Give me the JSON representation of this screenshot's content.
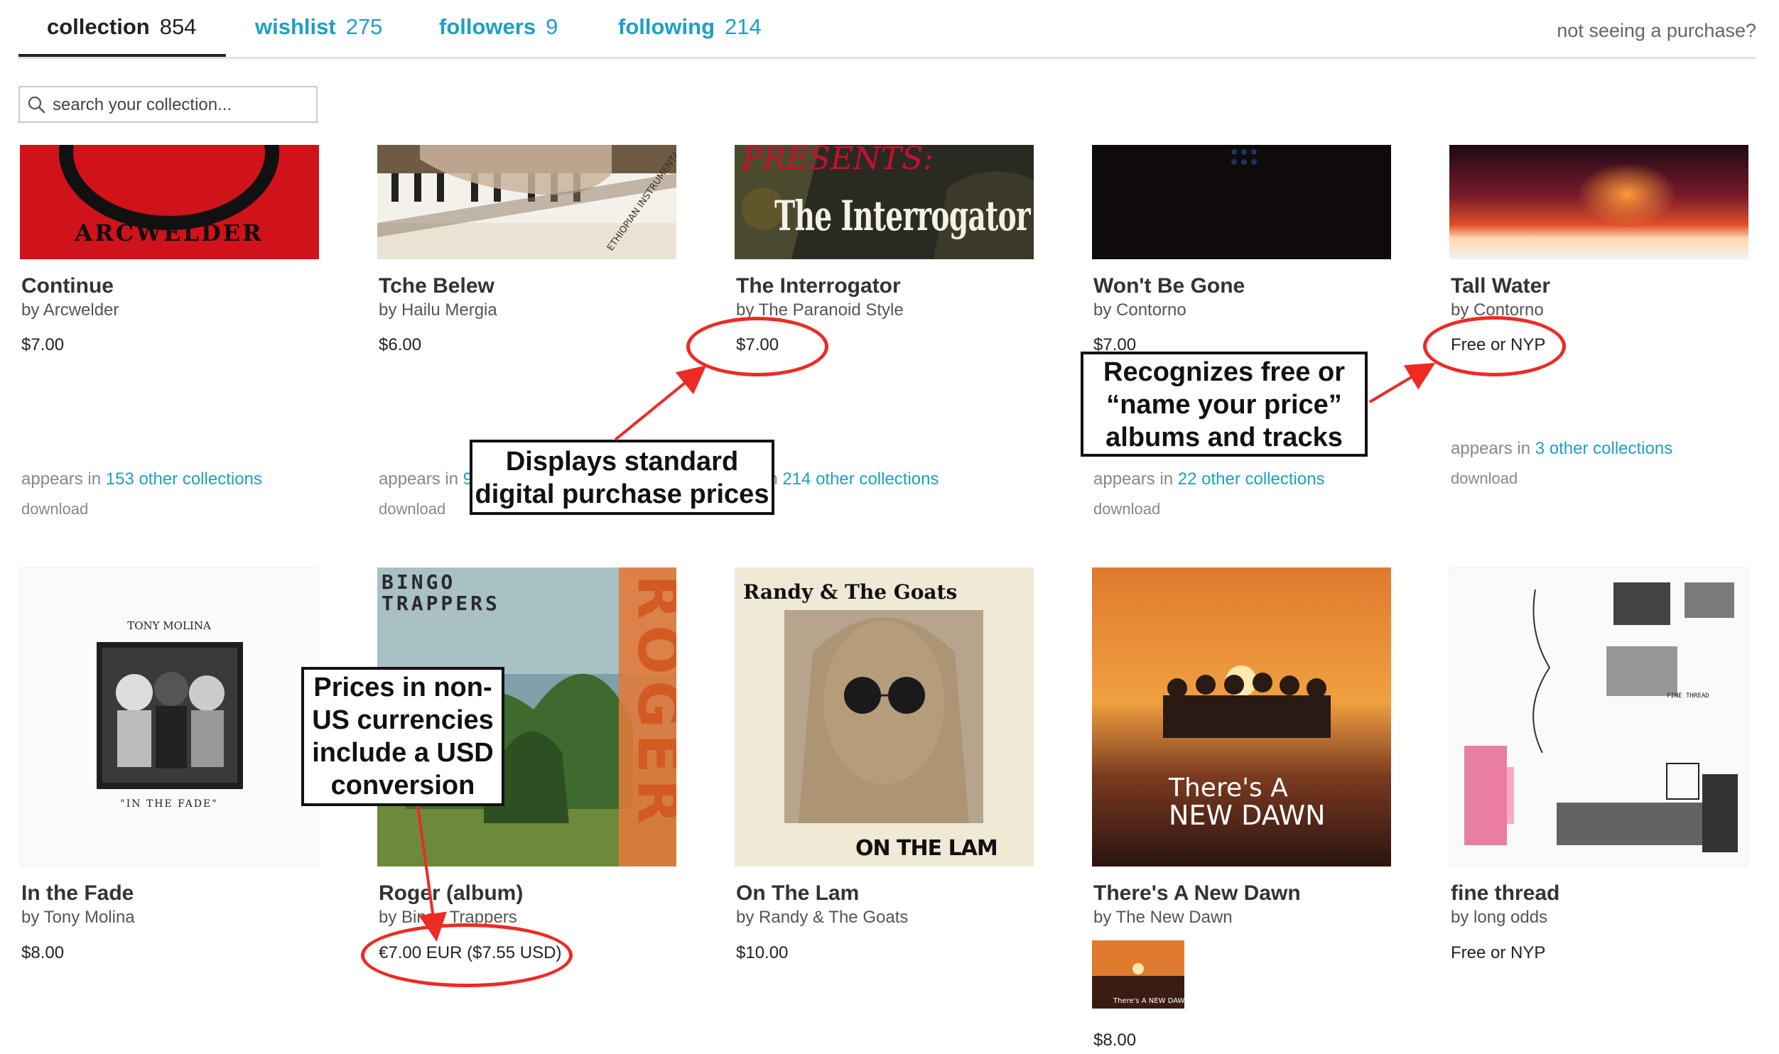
{
  "tabs": [
    {
      "label": "collection",
      "count": "854"
    },
    {
      "label": "wishlist",
      "count": "275"
    },
    {
      "label": "followers",
      "count": "9"
    },
    {
      "label": "following",
      "count": "214"
    }
  ],
  "not_seeing": "not seeing a purchase?",
  "search": {
    "placeholder": "search your collection...",
    "icon": "search-icon"
  },
  "items": [
    {
      "title": "Continue",
      "artist": "by Arcwelder",
      "price": "$7.00",
      "appears_prefix": "appears in ",
      "appears_link": "153 other collections",
      "download": "download",
      "art_text": "ARCWELDER"
    },
    {
      "title": "Tche Belew",
      "artist": "by Hailu Mergia",
      "price": "$6.00",
      "appears_prefix": "appears in ",
      "appears_link": "9",
      "download": "download",
      "art_text": "ETHIOPIAN INSTRUMENTALS"
    },
    {
      "title": "The Interrogator",
      "artist": "by The Paranoid Style",
      "price": "$7.00",
      "appears_prefix": "ars in ",
      "appears_link": "214 other collections",
      "download": "oad",
      "art_text": "The Interrogator",
      "art_text2": "PRESENTS:"
    },
    {
      "title": "Won't Be Gone",
      "artist": "by Contorno",
      "price": "$7.00",
      "appears_prefix": "appears in ",
      "appears_link": "22 other collections",
      "download": "download"
    },
    {
      "title": "Tall Water",
      "artist": "by Contorno",
      "price": "Free or NYP",
      "appears_prefix": "appears in ",
      "appears_link": "3 other collections",
      "download": "download"
    },
    {
      "title": "In the Fade",
      "artist": "by Tony Molina",
      "price": "$8.00",
      "art_text": "TONY MOLINA",
      "art_text2": "\"IN THE FADE\""
    },
    {
      "title": "Roger (album)",
      "artist": "by Bingo Trappers",
      "price": "€7.00 EUR ($7.55 USD)",
      "art_text": "BINGO",
      "art_text2": "TRAPPERS",
      "art_text3": "ROGER"
    },
    {
      "title": "On The Lam",
      "artist": "by Randy & The Goats",
      "price": "$10.00",
      "art_text": "Randy & The Goats",
      "art_text2": "ON THE LAM"
    },
    {
      "title": "There's A New Dawn",
      "artist": "by The New Dawn",
      "price": "$8.00",
      "art_text": "There's A",
      "art_text2": "NEW DAWN",
      "mini_text": "There's A NEW DAWN"
    },
    {
      "title": "fine thread",
      "artist": "by long odds",
      "price": "Free or NYP",
      "art_text": "FINE THREAD"
    }
  ],
  "annotations": [
    {
      "text": "Displays standard digital purchase prices"
    },
    {
      "text": "Recognizes free or “name your price” albums and tracks"
    },
    {
      "text": "Prices in non-US currencies include a USD conversion"
    }
  ],
  "colors": {
    "link": "#1da0c3",
    "annotation_red": "#ee2a24",
    "text": "#333333"
  }
}
